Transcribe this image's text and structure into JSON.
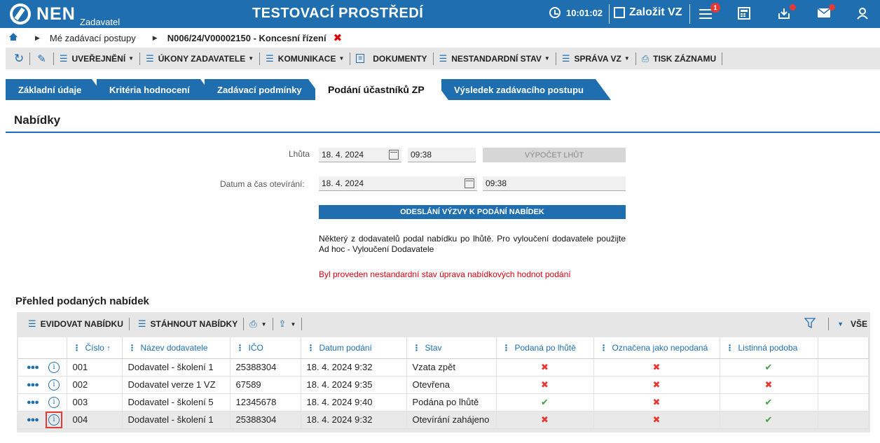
{
  "header": {
    "logo": "NEN",
    "logo_sub": "Zadavatel",
    "env_title": "TESTOVACÍ PROSTŘEDÍ",
    "clock": "10:01:02",
    "create_label": "Založit VZ",
    "menu_badge": "1"
  },
  "breadcrumb": {
    "item1": "Mé zadávací postupy",
    "item2": "N006/24/V00002150 - Koncesní řízení"
  },
  "toolbar": {
    "publish": "UVEŘEJNĚNÍ",
    "actions": "ÚKONY ZADAVATELE",
    "communication": "KOMUNIKACE",
    "documents": "DOKUMENTY",
    "nonstandard": "NESTANDARDNÍ STAV",
    "manage": "SPRÁVA VZ",
    "print": "TISK ZÁZNAMU"
  },
  "tabs": [
    "Základní údaje",
    "Kritéria hodnocení",
    "Zadávací podmínky",
    "Podání účastníků ZP",
    "Výsledek zadávacího postupu"
  ],
  "section_title": "Nabídky",
  "form": {
    "deadline_label": "Lhůta",
    "deadline_date": "18. 4. 2024",
    "deadline_time": "09:38",
    "calc_button": "VÝPOČET LHŮT",
    "opening_label": "Datum a čas otevírání:",
    "opening_date": "18. 4. 2024",
    "opening_time": "09:38",
    "send_button": "ODESLÁNÍ VÝZVY K PODÁNÍ NABÍDEK",
    "note": "Některý z dodavatelů podal nabídku po lhůtě. Pro vyloučení dodavatele použijte Ad hoc - Vyloučení Dodavatele",
    "warning": "Byl proveden nestandardní stav úprava nabídkových hodnot podání"
  },
  "grid": {
    "title": "Přehled podaných nabídek",
    "register": "EVIDOVAT NABÍDKU",
    "download": "STÁHNOUT NABÍDKY",
    "all": "VŠE",
    "columns": [
      "Číslo",
      "Název dodavatele",
      "IČO",
      "Datum podání",
      "Stav",
      "Podaná po lhůtě",
      "Označena jako nepodaná",
      "Listinná podoba"
    ],
    "rows": [
      {
        "num": "001",
        "name": "Dodavatel - školení 1",
        "ico": "25388304",
        "date": "18. 4. 2024 9:32",
        "state": "Vzata zpět",
        "late": false,
        "unsubmitted": false,
        "paper": true
      },
      {
        "num": "002",
        "name": "Dodavatel verze 1 VZ",
        "ico": "67589",
        "date": "18. 4. 2024 9:35",
        "state": "Otevřena",
        "late": false,
        "unsubmitted": false,
        "paper": false
      },
      {
        "num": "003",
        "name": "Dodavatel - školení 5",
        "ico": "12345678",
        "date": "18. 4. 2024 9:40",
        "state": "Podána po lhůtě",
        "late": true,
        "unsubmitted": false,
        "paper": true
      },
      {
        "num": "004",
        "name": "Dodavatel - školení 1",
        "ico": "25388304",
        "date": "18. 4. 2024 9:32",
        "state": "Otevírání zahájeno",
        "late": false,
        "unsubmitted": false,
        "paper": true
      }
    ]
  },
  "colors": {
    "brand": "#1f6fb0",
    "error": "#d8000c",
    "ok": "#43a047"
  }
}
